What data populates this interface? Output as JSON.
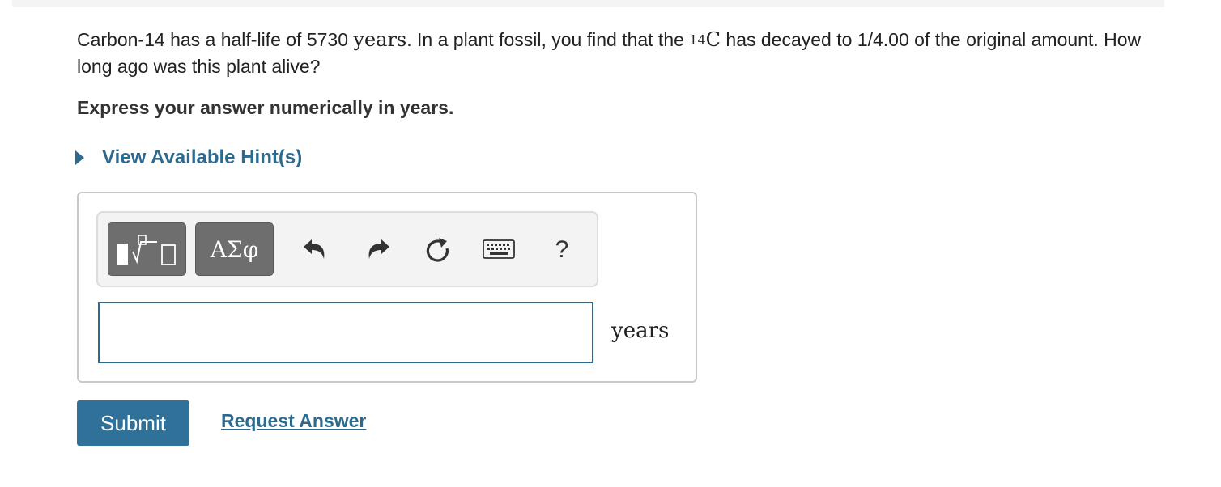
{
  "question": {
    "text_before": "Carbon-14 has a half-life of 5730 ",
    "math_years": "years",
    "text_mid": ". In a plant fossil, you find that the ",
    "isotope_mass": "14",
    "isotope_symbol": "C",
    "text_after": " has decayed to 1/4.00 of the original amount. How long ago was this plant alive?"
  },
  "instruction": "Express your answer numerically in years.",
  "hint": {
    "label": "View Available Hint(s)"
  },
  "toolbar": {
    "greek_label": "ΑΣφ",
    "help_label": "?",
    "icons": [
      "templates-icon",
      "undo-icon",
      "redo-icon",
      "reset-icon",
      "keyboard-icon",
      "help-icon"
    ]
  },
  "answer": {
    "value": "",
    "placeholder": "",
    "unit": "years"
  },
  "actions": {
    "submit_label": "Submit",
    "request_label": "Request Answer"
  },
  "colors": {
    "accent": "#2c6b8f",
    "submit_bg": "#2f7199",
    "toolbar_button": "#6e6e6e"
  }
}
